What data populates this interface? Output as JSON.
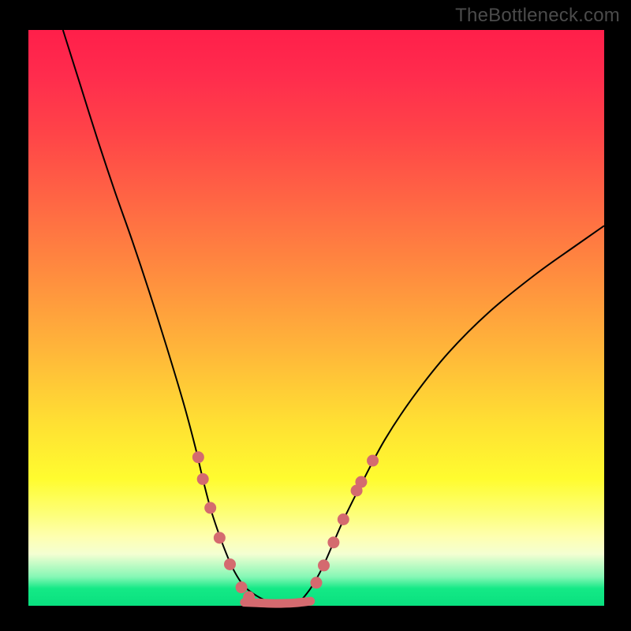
{
  "watermark": "TheBottleneck.com",
  "chart_data": {
    "type": "line",
    "title": "",
    "xlabel": "",
    "ylabel": "",
    "xlim": [
      0,
      1
    ],
    "ylim": [
      0,
      1
    ],
    "grid": false,
    "series": [
      {
        "name": "left-curve",
        "color": "#000000",
        "x": [
          0.06,
          0.09,
          0.12,
          0.15,
          0.18,
          0.21,
          0.24,
          0.27,
          0.29,
          0.303,
          0.316,
          0.329,
          0.342,
          0.355,
          0.37,
          0.385,
          0.41,
          0.44
        ],
        "y": [
          1.0,
          0.905,
          0.81,
          0.72,
          0.635,
          0.545,
          0.45,
          0.35,
          0.275,
          0.22,
          0.17,
          0.13,
          0.095,
          0.065,
          0.04,
          0.025,
          0.01,
          0.0
        ]
      },
      {
        "name": "right-curve",
        "color": "#000000",
        "x": [
          0.47,
          0.49,
          0.51,
          0.53,
          0.55,
          0.58,
          0.62,
          0.67,
          0.73,
          0.8,
          0.88,
          0.95,
          1.0
        ],
        "y": [
          0.005,
          0.03,
          0.065,
          0.11,
          0.155,
          0.215,
          0.29,
          0.365,
          0.44,
          0.51,
          0.575,
          0.625,
          0.66
        ]
      },
      {
        "name": "valley-flat",
        "color": "#d46a6f",
        "x": [
          0.375,
          0.4,
          0.43,
          0.462,
          0.49
        ],
        "y": [
          0.006,
          0.005,
          0.004,
          0.005,
          0.008
        ]
      }
    ],
    "markers": [
      {
        "group": "dots-left",
        "color": "#d46a6f",
        "x": 0.295,
        "y": 0.258
      },
      {
        "group": "dots-left",
        "color": "#d46a6f",
        "x": 0.303,
        "y": 0.22
      },
      {
        "group": "dots-left",
        "color": "#d46a6f",
        "x": 0.316,
        "y": 0.17
      },
      {
        "group": "dots-left",
        "color": "#d46a6f",
        "x": 0.332,
        "y": 0.118
      },
      {
        "group": "dots-left",
        "color": "#d46a6f",
        "x": 0.35,
        "y": 0.072
      },
      {
        "group": "dots-left",
        "color": "#d46a6f",
        "x": 0.37,
        "y": 0.032
      },
      {
        "group": "dots-left",
        "color": "#d46a6f",
        "x": 0.383,
        "y": 0.015
      },
      {
        "group": "dots-right",
        "color": "#d46a6f",
        "x": 0.5,
        "y": 0.04
      },
      {
        "group": "dots-right",
        "color": "#d46a6f",
        "x": 0.513,
        "y": 0.07
      },
      {
        "group": "dots-right",
        "color": "#d46a6f",
        "x": 0.53,
        "y": 0.11
      },
      {
        "group": "dots-right",
        "color": "#d46a6f",
        "x": 0.547,
        "y": 0.15
      },
      {
        "group": "dots-right",
        "color": "#d46a6f",
        "x": 0.57,
        "y": 0.2
      },
      {
        "group": "dots-right",
        "color": "#d46a6f",
        "x": 0.578,
        "y": 0.215
      },
      {
        "group": "dots-right",
        "color": "#d46a6f",
        "x": 0.598,
        "y": 0.252
      }
    ]
  }
}
